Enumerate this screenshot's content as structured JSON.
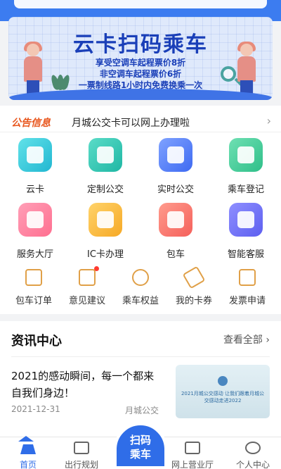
{
  "banner": {
    "title": "云卡扫码乘车",
    "line1": "享受空调车起程票价8折",
    "line2": "非空调车起程票价6折",
    "line3": "一票制线路1小时内免费换乘一次"
  },
  "notice": {
    "tag": "公告信息",
    "text": "月城公交卡可以网上办理啦"
  },
  "services": [
    {
      "label": "云卡",
      "icon": "card-icon"
    },
    {
      "label": "定制公交",
      "icon": "bus-icon"
    },
    {
      "label": "实时公交",
      "icon": "realtime-bus-icon"
    },
    {
      "label": "乘车登记",
      "icon": "ticket-register-icon"
    },
    {
      "label": "服务大厅",
      "icon": "service-hall-icon"
    },
    {
      "label": "IC卡办理",
      "icon": "ic-card-icon"
    },
    {
      "label": "包车",
      "icon": "car-icon"
    },
    {
      "label": "智能客服",
      "icon": "robot-icon"
    }
  ],
  "shortcuts": [
    {
      "label": "包车订单",
      "icon": "order-icon"
    },
    {
      "label": "意见建议",
      "icon": "feedback-icon",
      "badge": true
    },
    {
      "label": "乘车权益",
      "icon": "badge-icon"
    },
    {
      "label": "我的卡券",
      "icon": "coupon-icon"
    },
    {
      "label": "发票申请",
      "icon": "invoice-icon"
    }
  ],
  "news": {
    "heading": "资讯中心",
    "more": "查看全部",
    "item": {
      "title": "2021的感动瞬间，每一个都来自我们身边！",
      "date": "2021-12-31",
      "source": "月城公交",
      "thumb_caption": "2021月城公交感动\n让我们跟着月城公交感动走进2022"
    }
  },
  "nav": {
    "home": "首页",
    "travel": "出行规划",
    "scan_l1": "扫码",
    "scan_l2": "乘车",
    "hall": "网上营业厅",
    "me": "个人中心"
  },
  "colors": {
    "primary": "#2f6de8",
    "notice_tag": "#e8561d",
    "badge": "#ff3b30"
  }
}
